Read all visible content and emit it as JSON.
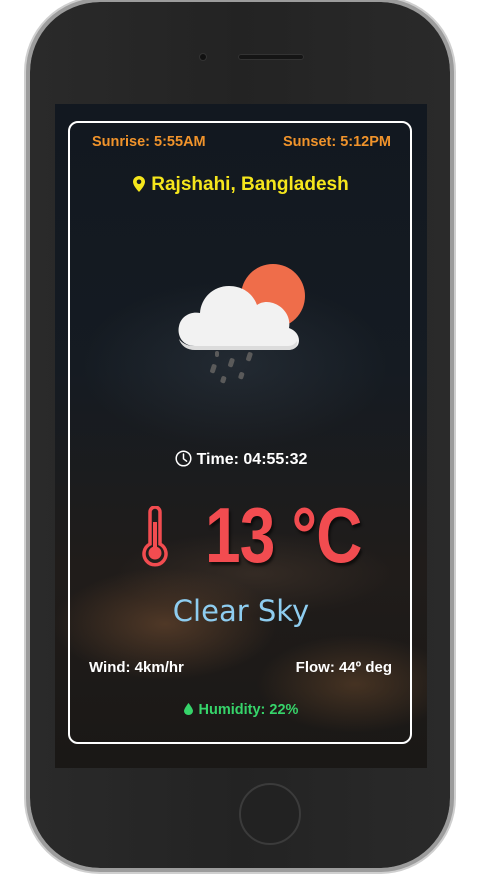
{
  "sun": {
    "sunrise": "Sunrise: 5:55AM",
    "sunset": "Sunset: 5:12PM"
  },
  "location": {
    "label": "Rajshahi, Bangladesh",
    "icon": "map-pin-icon"
  },
  "weather_icon": "cloud-sun-rain-icon",
  "time": {
    "label": "Time: 04:55:32",
    "icon": "clock-icon"
  },
  "temperature": {
    "value": "13 °C",
    "icon": "thermometer-icon"
  },
  "description": "Clear Sky",
  "wind": {
    "speed": "Wind: 4km/hr",
    "flow": "Flow: 44º deg"
  },
  "humidity": {
    "label": "Humidity: 22%",
    "icon": "droplet-icon"
  },
  "colors": {
    "sun_text": "#f0932b",
    "location_text": "#f5e61c",
    "temperature": "#f24c50",
    "description": "#8ecdf0",
    "humidity": "#36d46a",
    "sun_icon": "#ef6d4a"
  }
}
